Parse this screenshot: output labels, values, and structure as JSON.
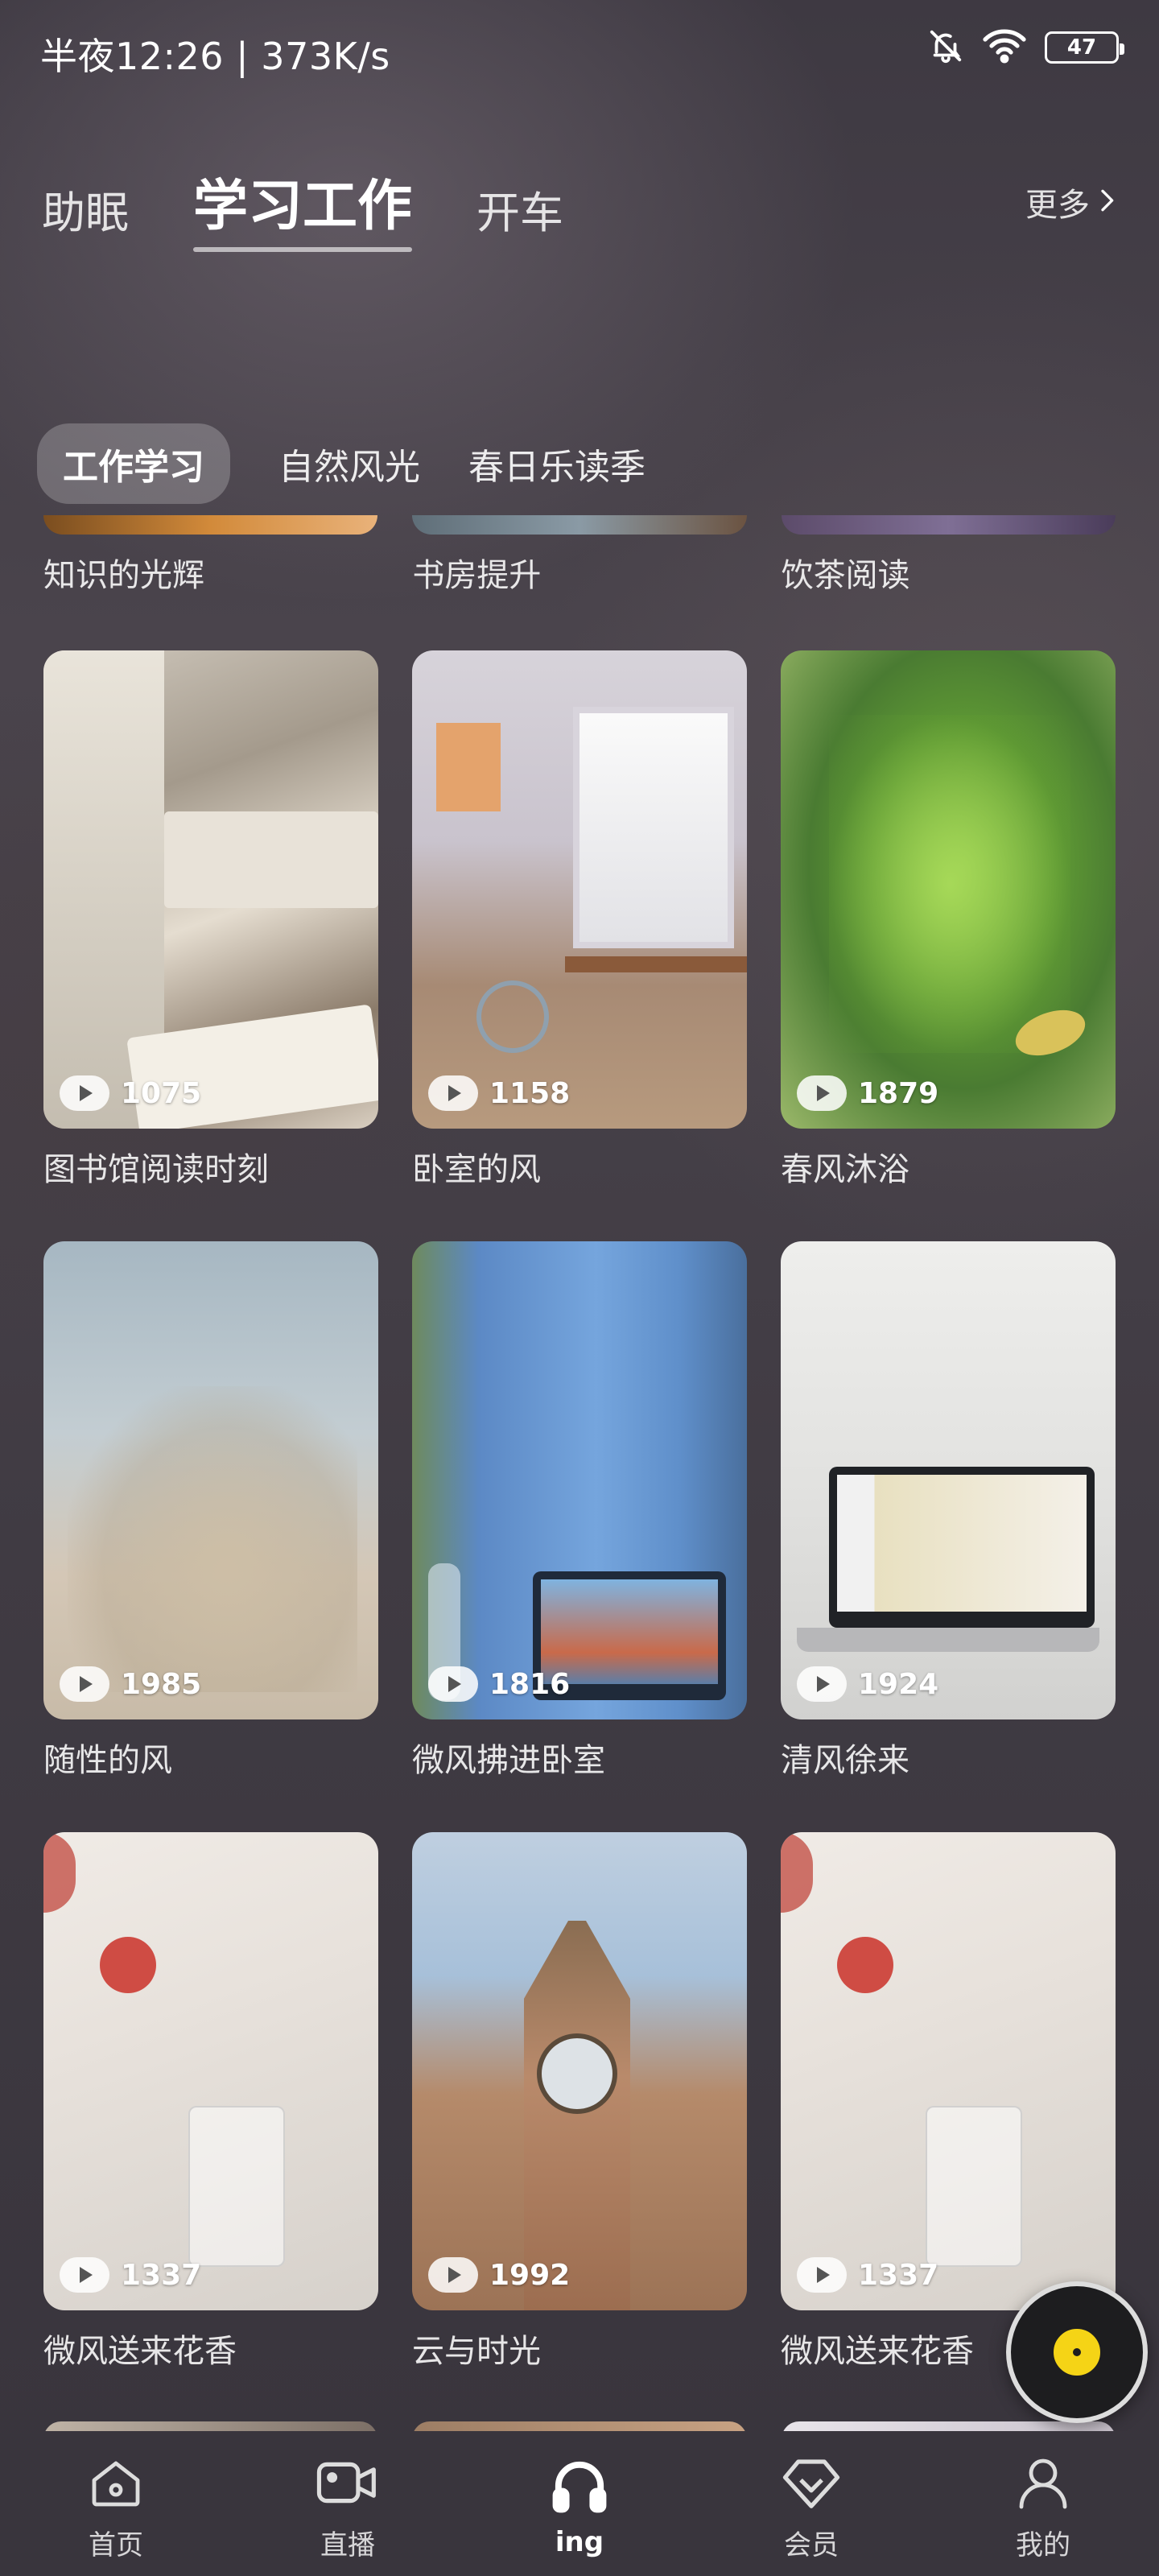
{
  "status_bar": {
    "time": "半夜12:26 | 373K/s",
    "battery": "47"
  },
  "top_tabs": [
    {
      "label": "助眠",
      "active": false
    },
    {
      "label": "学习工作",
      "active": true
    },
    {
      "label": "开车",
      "active": false
    }
  ],
  "more_label": "更多",
  "sub_tabs": [
    {
      "label": "工作学习",
      "active": true
    },
    {
      "label": "自然风光",
      "active": false
    },
    {
      "label": "春日乐读季",
      "active": false
    }
  ],
  "partial_row": [
    "知识的光辉",
    "书房提升",
    "饮茶阅读"
  ],
  "cards": [
    {
      "title": "图书馆阅读时刻",
      "count": "1075"
    },
    {
      "title": "卧室的风",
      "count": "1158"
    },
    {
      "title": "春风沐浴",
      "count": "1879"
    },
    {
      "title": "随性的风",
      "count": "1985"
    },
    {
      "title": "微风拂进卧室",
      "count": "1816"
    },
    {
      "title": "清风徐来",
      "count": "1924"
    },
    {
      "title": "微风送来花香",
      "count": "1337"
    },
    {
      "title": "云与时光",
      "count": "1992"
    },
    {
      "title": "微风送来花香",
      "count": "1337"
    }
  ],
  "bottom_nav": [
    {
      "label": "首页",
      "icon": "home-icon",
      "active": false
    },
    {
      "label": "直播",
      "icon": "video-icon",
      "active": false
    },
    {
      "label": "ing",
      "icon": "headphones-icon",
      "active": true
    },
    {
      "label": "会员",
      "icon": "diamond-icon",
      "active": false
    },
    {
      "label": "我的",
      "icon": "user-icon",
      "active": false
    }
  ],
  "colors": {
    "accent": "#f5d416",
    "background": "#45404a"
  }
}
